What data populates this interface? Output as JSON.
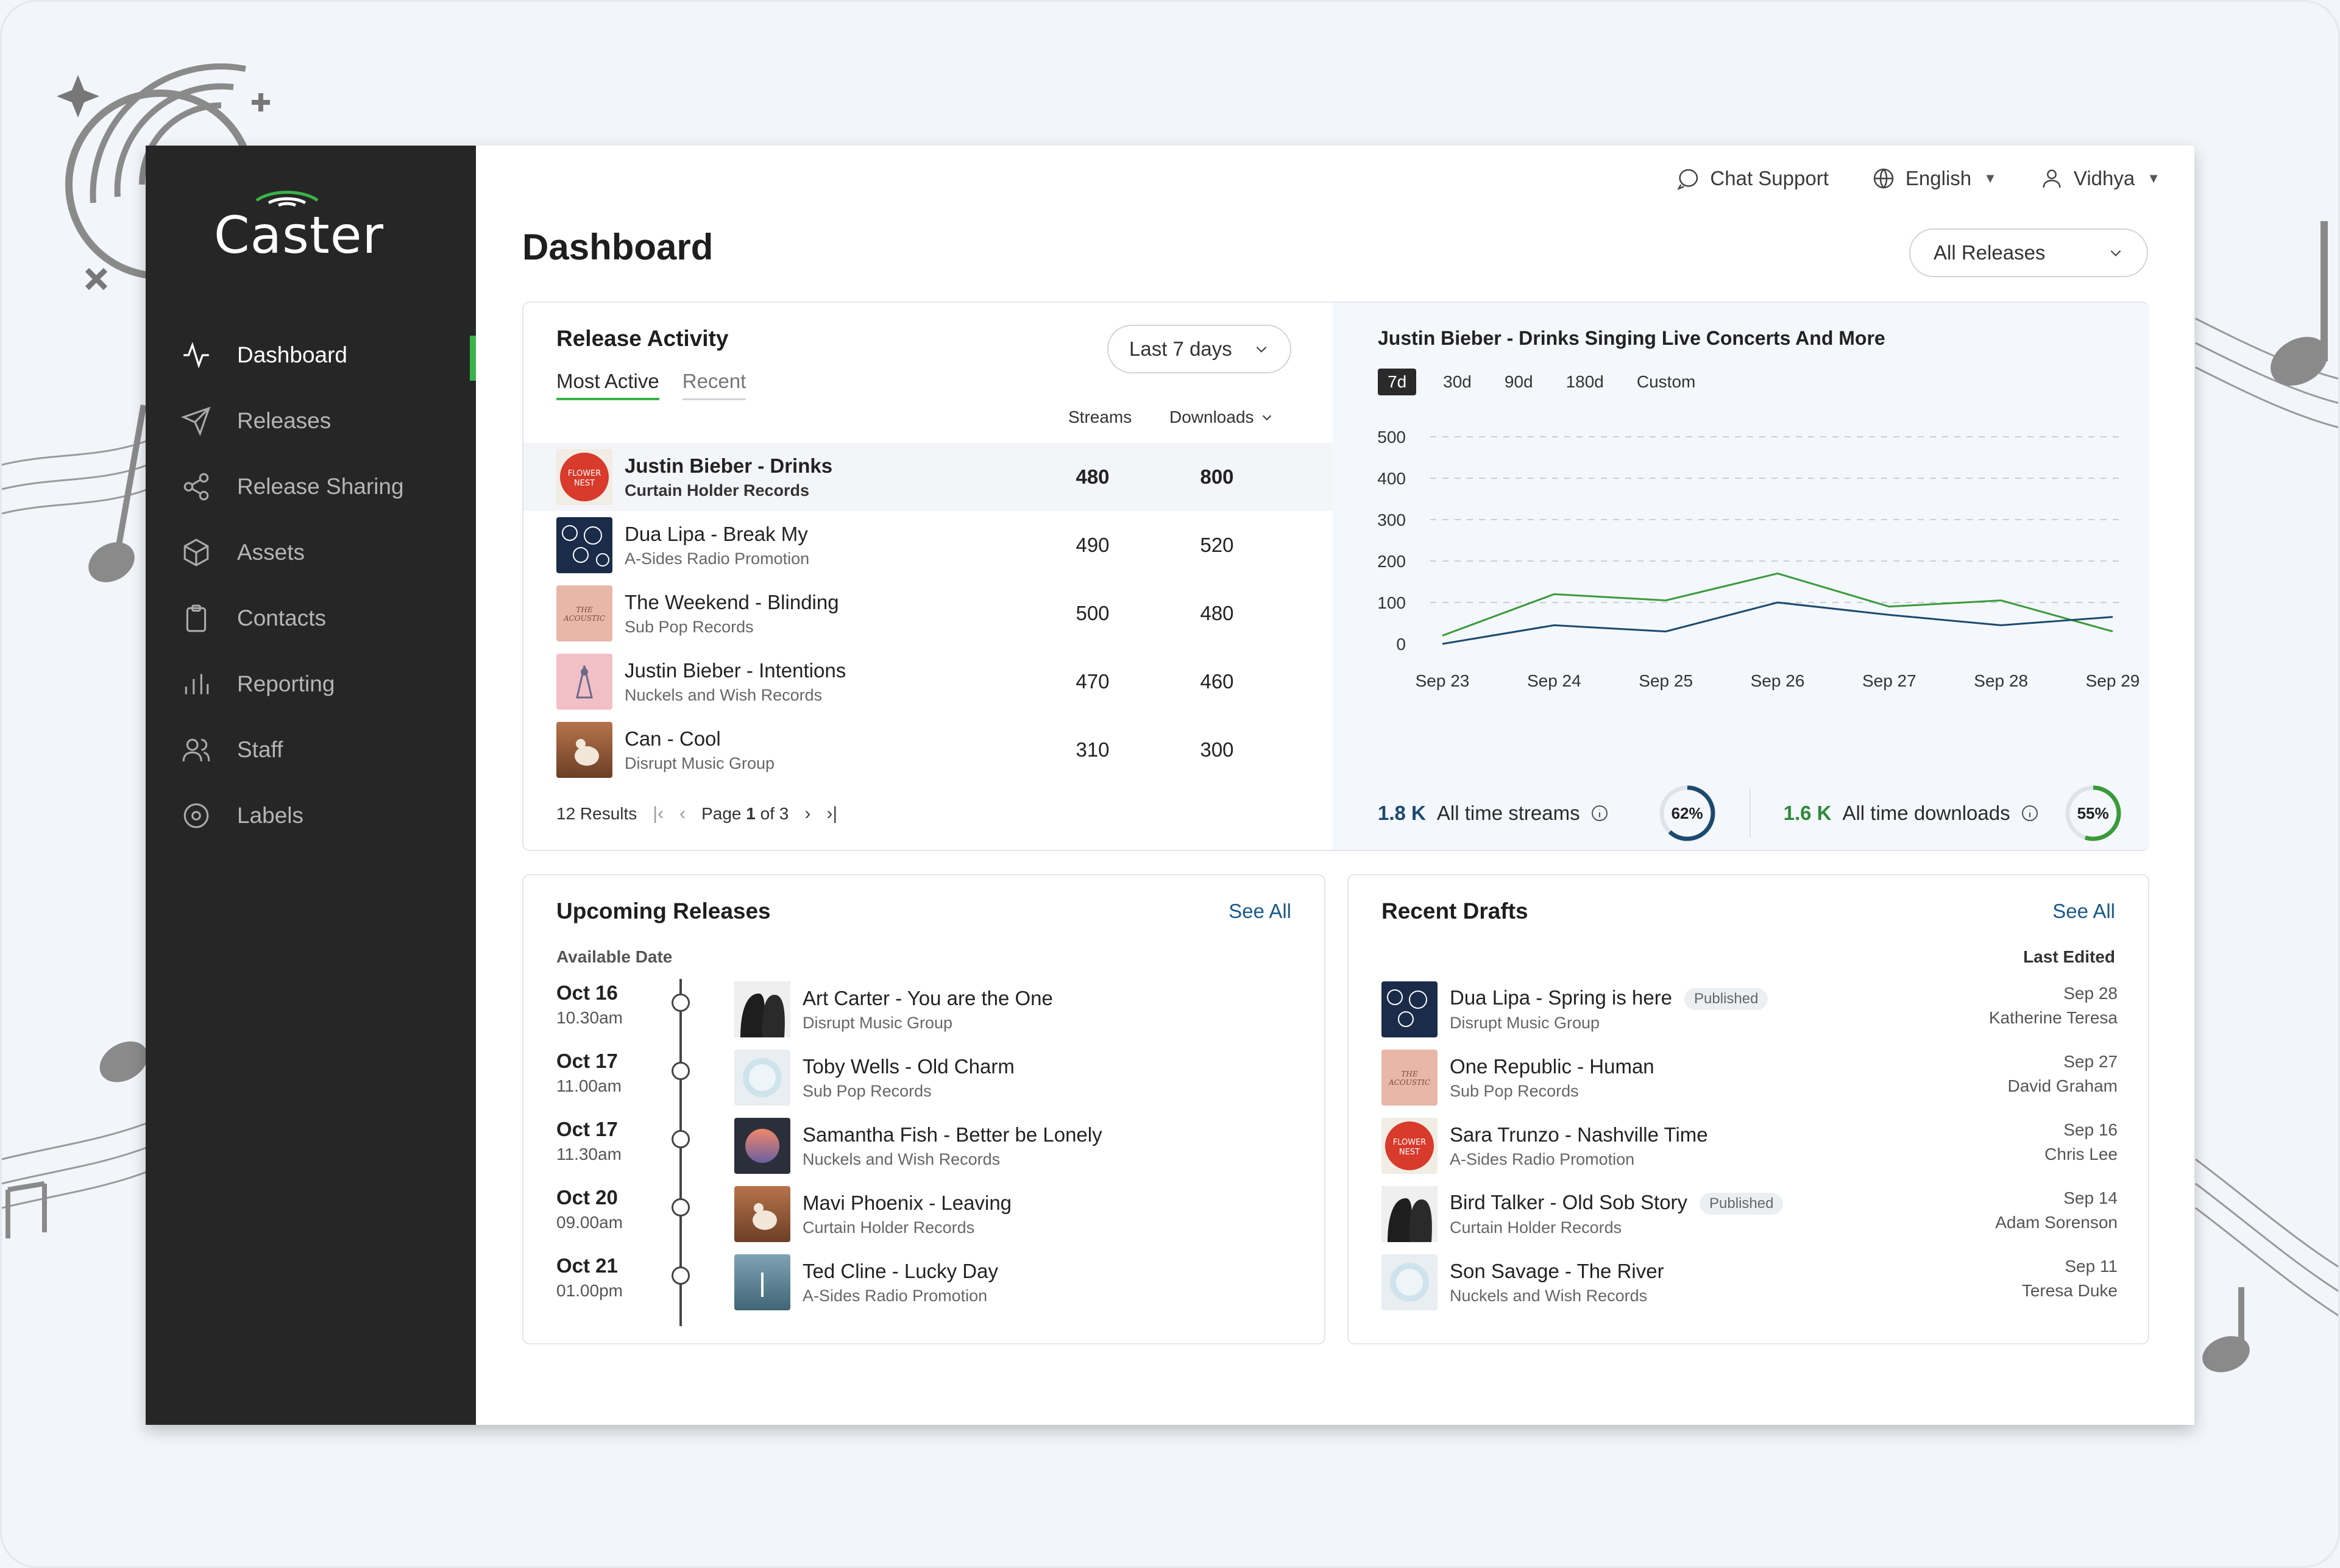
{
  "app": {
    "name": "Caster"
  },
  "sidebar": {
    "items": [
      {
        "label": "Dashboard",
        "icon": "activity-icon",
        "active": true
      },
      {
        "label": "Releases",
        "icon": "send-icon"
      },
      {
        "label": "Release Sharing",
        "icon": "share-icon"
      },
      {
        "label": "Assets",
        "icon": "box-icon"
      },
      {
        "label": "Contacts",
        "icon": "clipboard-icon"
      },
      {
        "label": "Reporting",
        "icon": "bar-chart-icon"
      },
      {
        "label": "Staff",
        "icon": "users-icon"
      },
      {
        "label": "Labels",
        "icon": "disc-icon"
      }
    ]
  },
  "topbar": {
    "chat": "Chat Support",
    "language": "English",
    "user": "Vidhya"
  },
  "page": {
    "title": "Dashboard",
    "filter": "All Releases"
  },
  "activity": {
    "title": "Release Activity",
    "tabs": [
      "Most Active",
      "Recent"
    ],
    "period": "Last 7 days",
    "col_streams": "Streams",
    "col_downloads": "Downloads",
    "rows": [
      {
        "title": "Justin Bieber - Drinks",
        "label": "Curtain Holder Records",
        "streams": "480",
        "downloads": "800"
      },
      {
        "title": "Dua Lipa - Break My",
        "label": "A-Sides Radio Promotion",
        "streams": "490",
        "downloads": "520"
      },
      {
        "title": "The Weekend - Blinding",
        "label": "Sub Pop Records",
        "streams": "500",
        "downloads": "480"
      },
      {
        "title": "Justin Bieber - Intentions",
        "label": "Nuckels and Wish Records",
        "streams": "470",
        "downloads": "460"
      },
      {
        "title": "Can - Cool",
        "label": "Disrupt Music Group",
        "streams": "310",
        "downloads": "300"
      }
    ],
    "results": "12 Results",
    "page_prefix": "Page",
    "page_current": "1",
    "page_suffix": "of 3"
  },
  "chart_panel": {
    "title": "Justin Bieber - Drinks Singing Live Concerts And More",
    "ranges": [
      "7d",
      "30d",
      "90d",
      "180d",
      "Custom"
    ],
    "streams_value": "1.8 K",
    "streams_label": "All time streams",
    "streams_pct": "62%",
    "downloads_value": "1.6 K",
    "downloads_label": "All time downloads",
    "downloads_pct": "55%",
    "colors": {
      "streams": "#1c4a6e",
      "downloads": "#3a9a3a"
    }
  },
  "chart_data": {
    "type": "line",
    "x": [
      "Sep 23",
      "Sep 24",
      "Sep 25",
      "Sep 26",
      "Sep 27",
      "Sep 28",
      "Sep 29"
    ],
    "yticks": [
      0,
      100,
      200,
      300,
      400,
      500
    ],
    "ylim": [
      0,
      500
    ],
    "grid": true,
    "series": [
      {
        "values": [
          20,
          120,
          105,
          170,
          90,
          105,
          30
        ],
        "color": "#3a9a3a"
      },
      {
        "values": [
          0,
          45,
          30,
          100,
          70,
          45,
          65
        ],
        "color": "#1c4a6e"
      }
    ]
  },
  "upcoming": {
    "title": "Upcoming Releases",
    "see_all": "See All",
    "sub_head": "Available Date",
    "rows": [
      {
        "date": "Oct 16",
        "time": "10.30am",
        "title": "Art Carter - You are the One",
        "label": "Disrupt Music Group"
      },
      {
        "date": "Oct 17",
        "time": "11.00am",
        "title": "Toby Wells - Old Charm",
        "label": "Sub Pop Records"
      },
      {
        "date": "Oct 17",
        "time": "11.30am",
        "title": "Samantha Fish - Better be Lonely",
        "label": "Nuckels and Wish Records"
      },
      {
        "date": "Oct 20",
        "time": "09.00am",
        "title": "Mavi Phoenix - Leaving",
        "label": "Curtain Holder Records"
      },
      {
        "date": "Oct 21",
        "time": "01.00pm",
        "title": "Ted Cline - Lucky Day",
        "label": "A-Sides Radio Promotion"
      }
    ]
  },
  "drafts": {
    "title": "Recent Drafts",
    "see_all": "See All",
    "sub_head": "Last Edited",
    "rows": [
      {
        "title": "Dua Lipa - Spring is here",
        "badge": "Published",
        "label": "Disrupt Music Group",
        "date": "Sep 28",
        "editor": "Katherine Teresa"
      },
      {
        "title": "One Republic - Human",
        "badge": "",
        "label": "Sub Pop Records",
        "date": "Sep 27",
        "editor": "David Graham"
      },
      {
        "title": "Sara Trunzo - Nashville Time",
        "badge": "",
        "label": "A-Sides Radio Promotion",
        "date": "Sep 16",
        "editor": "Chris Lee"
      },
      {
        "title": "Bird Talker - Old Sob Story",
        "badge": "Published",
        "label": "Curtain Holder Records",
        "date": "Sep 14",
        "editor": "Adam Sorenson"
      },
      {
        "title": "Son Savage - The River",
        "badge": "",
        "label": "Nuckels and Wish Records",
        "date": "Sep 11",
        "editor": "Teresa Duke"
      }
    ]
  }
}
